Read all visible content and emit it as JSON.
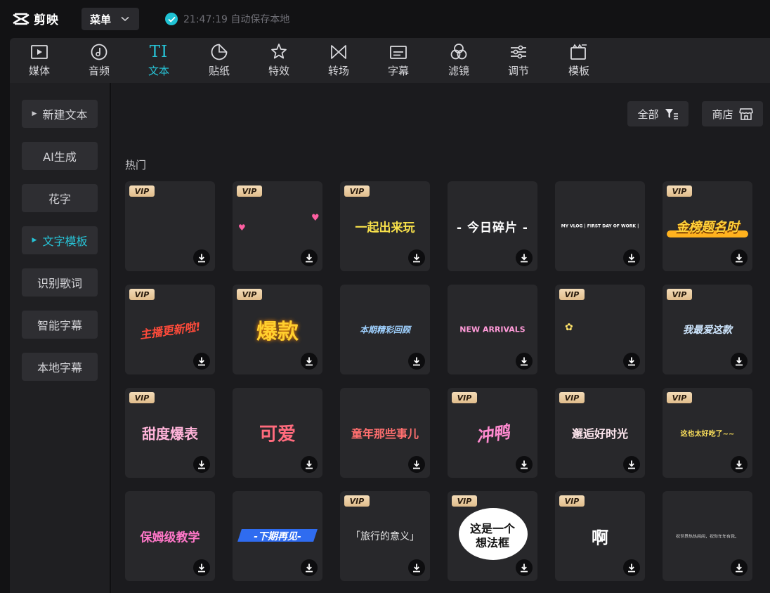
{
  "app": {
    "name": "剪映"
  },
  "menu": {
    "label": "菜单"
  },
  "autosave": {
    "text": "21:47:19 自动保存本地"
  },
  "tabs": [
    {
      "label": "媒体",
      "icon": "media-icon"
    },
    {
      "label": "音频",
      "icon": "audio-icon"
    },
    {
      "label": "文本",
      "icon": "text-icon",
      "glyph": "TI",
      "active": true
    },
    {
      "label": "贴纸",
      "icon": "sticker-icon"
    },
    {
      "label": "特效",
      "icon": "effects-icon"
    },
    {
      "label": "转场",
      "icon": "transition-icon"
    },
    {
      "label": "字幕",
      "icon": "subtitle-icon"
    },
    {
      "label": "滤镜",
      "icon": "filter-icon"
    },
    {
      "label": "调节",
      "icon": "adjust-icon"
    },
    {
      "label": "模板",
      "icon": "template-icon"
    }
  ],
  "sidebar": [
    {
      "label": "新建文本",
      "caret": true
    },
    {
      "label": "AI生成"
    },
    {
      "label": "花字"
    },
    {
      "label": "文字模板",
      "caret": true,
      "active": true
    },
    {
      "label": "识别歌词"
    },
    {
      "label": "智能字幕"
    },
    {
      "label": "本地字幕"
    }
  ],
  "toolbar": {
    "filter_label": "全部",
    "store_label": "商店"
  },
  "section": {
    "title": "热门"
  },
  "vip_label": "VIP",
  "templates": [
    {
      "text": "",
      "vip": true,
      "color": "#ffffff"
    },
    {
      "text": "",
      "vip": true,
      "color": "#ff5fa2"
    },
    {
      "text": "一起出来玩",
      "vip": true,
      "color": "#f7e04a"
    },
    {
      "text": "- 今日碎片 -",
      "vip": false,
      "color": "#ffffff"
    },
    {
      "text": "MY VLOG | FIRST DAY OF WORK |",
      "vip": false,
      "color": "#ffffff"
    },
    {
      "text": "金榜题名时",
      "vip": true,
      "color": "#ffd23a"
    },
    {
      "text": "主播更新啦!",
      "vip": true,
      "color": "#ff4b3a"
    },
    {
      "text": "爆款",
      "vip": true,
      "color": "#ffcf2e"
    },
    {
      "text": "本期精彩回顾",
      "vip": false,
      "color": "#9fd1ff"
    },
    {
      "text": "NEW ARRIVALS",
      "vip": false,
      "color": "#ff9ad8"
    },
    {
      "text": "",
      "vip": true,
      "color": "#ffe36a"
    },
    {
      "text": "我最爱这款",
      "vip": true,
      "color": "#cfe7ff"
    },
    {
      "text": "甜度爆表",
      "vip": true,
      "color": "#ffb3d9"
    },
    {
      "text": "可爱",
      "vip": false,
      "color": "#ff6b7d"
    },
    {
      "text": "童年那些事儿",
      "vip": false,
      "color": "#ff6f6f"
    },
    {
      "text": "冲鸭",
      "vip": true,
      "color": "#ff8ad0"
    },
    {
      "text": "邂逅好时光",
      "vip": true,
      "color": "#ffe7ef"
    },
    {
      "text": "这也太好吃了~~",
      "vip": true,
      "color": "#ffe35c"
    },
    {
      "text": "保姆级教学",
      "vip": false,
      "color": "#ff77c8"
    },
    {
      "text": "-下期再见-",
      "vip": false,
      "color": "#ffffff"
    },
    {
      "text": "「旅行的意义」",
      "vip": true,
      "color": "#e6e6e6"
    },
    {
      "text": "这是一个想法框",
      "vip": true,
      "color": "#111111"
    },
    {
      "text": "啊",
      "vip": true,
      "color": "#ffffff"
    },
    {
      "text": "祝世界热热闹闹，祝你年年有我。",
      "vip": false,
      "color": "#cccccc"
    }
  ]
}
